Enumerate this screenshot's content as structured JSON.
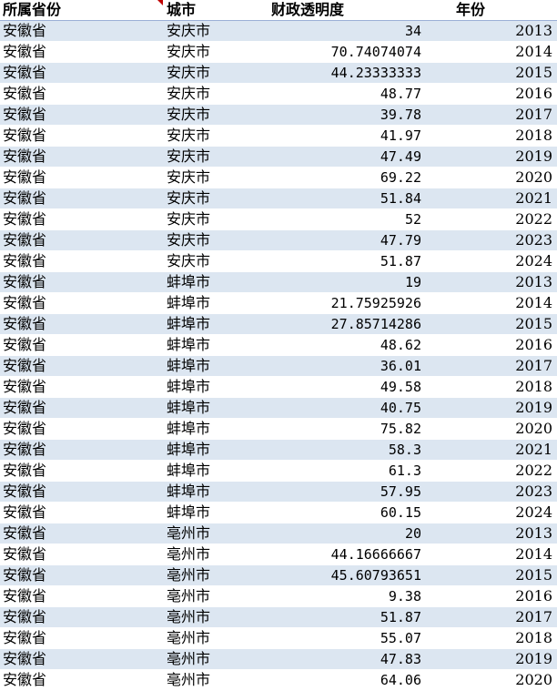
{
  "columns": [
    "所属省份",
    "城市",
    "财政透明度",
    "年份"
  ],
  "rows": [
    [
      "安徽省",
      "安庆市",
      "34",
      "2013"
    ],
    [
      "安徽省",
      "安庆市",
      "70.74074074",
      "2014"
    ],
    [
      "安徽省",
      "安庆市",
      "44.23333333",
      "2015"
    ],
    [
      "安徽省",
      "安庆市",
      "48.77",
      "2016"
    ],
    [
      "安徽省",
      "安庆市",
      "39.78",
      "2017"
    ],
    [
      "安徽省",
      "安庆市",
      "41.97",
      "2018"
    ],
    [
      "安徽省",
      "安庆市",
      "47.49",
      "2019"
    ],
    [
      "安徽省",
      "安庆市",
      "69.22",
      "2020"
    ],
    [
      "安徽省",
      "安庆市",
      "51.84",
      "2021"
    ],
    [
      "安徽省",
      "安庆市",
      "52",
      "2022"
    ],
    [
      "安徽省",
      "安庆市",
      "47.79",
      "2023"
    ],
    [
      "安徽省",
      "安庆市",
      "51.87",
      "2024"
    ],
    [
      "安徽省",
      "蚌埠市",
      "19",
      "2013"
    ],
    [
      "安徽省",
      "蚌埠市",
      "21.75925926",
      "2014"
    ],
    [
      "安徽省",
      "蚌埠市",
      "27.85714286",
      "2015"
    ],
    [
      "安徽省",
      "蚌埠市",
      "48.62",
      "2016"
    ],
    [
      "安徽省",
      "蚌埠市",
      "36.01",
      "2017"
    ],
    [
      "安徽省",
      "蚌埠市",
      "49.58",
      "2018"
    ],
    [
      "安徽省",
      "蚌埠市",
      "40.75",
      "2019"
    ],
    [
      "安徽省",
      "蚌埠市",
      "75.82",
      "2020"
    ],
    [
      "安徽省",
      "蚌埠市",
      "58.3",
      "2021"
    ],
    [
      "安徽省",
      "蚌埠市",
      "61.3",
      "2022"
    ],
    [
      "安徽省",
      "蚌埠市",
      "57.95",
      "2023"
    ],
    [
      "安徽省",
      "蚌埠市",
      "60.15",
      "2024"
    ],
    [
      "安徽省",
      "亳州市",
      "20",
      "2013"
    ],
    [
      "安徽省",
      "亳州市",
      "44.16666667",
      "2014"
    ],
    [
      "安徽省",
      "亳州市",
      "45.60793651",
      "2015"
    ],
    [
      "安徽省",
      "亳州市",
      "9.38",
      "2016"
    ],
    [
      "安徽省",
      "亳州市",
      "51.87",
      "2017"
    ],
    [
      "安徽省",
      "亳州市",
      "55.07",
      "2018"
    ],
    [
      "安徽省",
      "亳州市",
      "47.83",
      "2019"
    ],
    [
      "安徽省",
      "亳州市",
      "64.06",
      "2020"
    ]
  ],
  "colors": {
    "band": "#dce6f1",
    "header_border": "#9bb0d6",
    "marker": "#c00000"
  }
}
